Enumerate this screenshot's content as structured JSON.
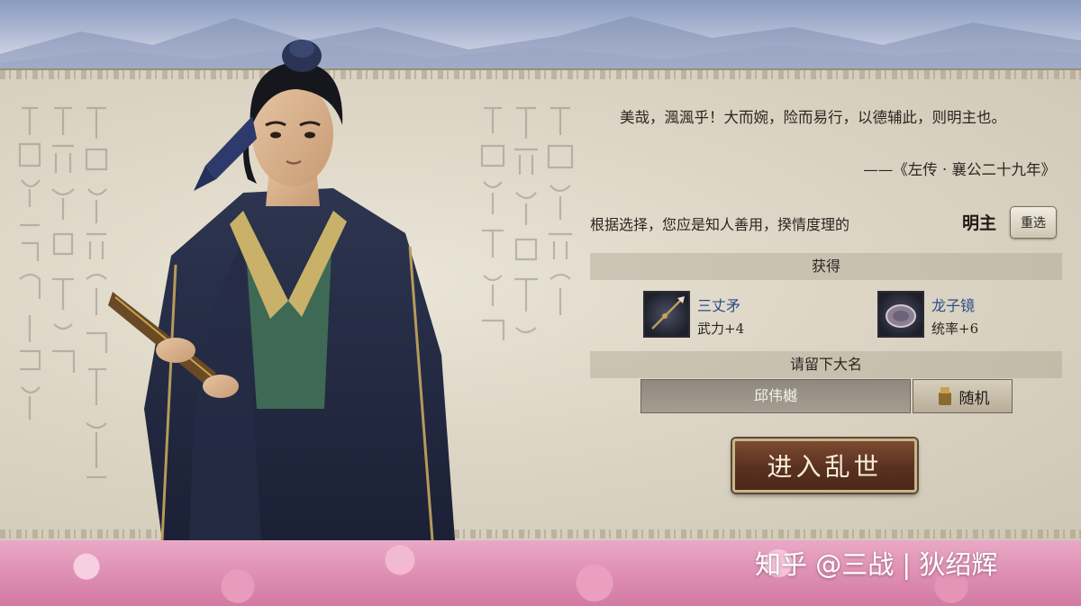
{
  "quote": {
    "text": "美哉，渢渢乎！大而婉，险而易行，以德辅此，则明主也。",
    "source": "——《左传 · 襄公二十九年》"
  },
  "result": {
    "text": "根据选择，您应是知人善用，揆情度理的",
    "ruler_type": "明主",
    "reroll_label": "重选"
  },
  "rewards": {
    "header": "获得",
    "items": [
      {
        "name": "三丈矛",
        "stat": "武力+4",
        "icon": "spear-icon"
      },
      {
        "name": "龙子镜",
        "stat": "统率+6",
        "icon": "mirror-icon"
      }
    ]
  },
  "naming": {
    "header": "请留下大名",
    "name_value": "邱伟樾",
    "random_label": "随机"
  },
  "enter_label": "进入乱世",
  "watermark": "知乎 @三战 | 狄绍辉",
  "colors": {
    "item_name": "#2d4a88",
    "enter_button": "#5a3120",
    "blossom": "#df8fb4"
  }
}
